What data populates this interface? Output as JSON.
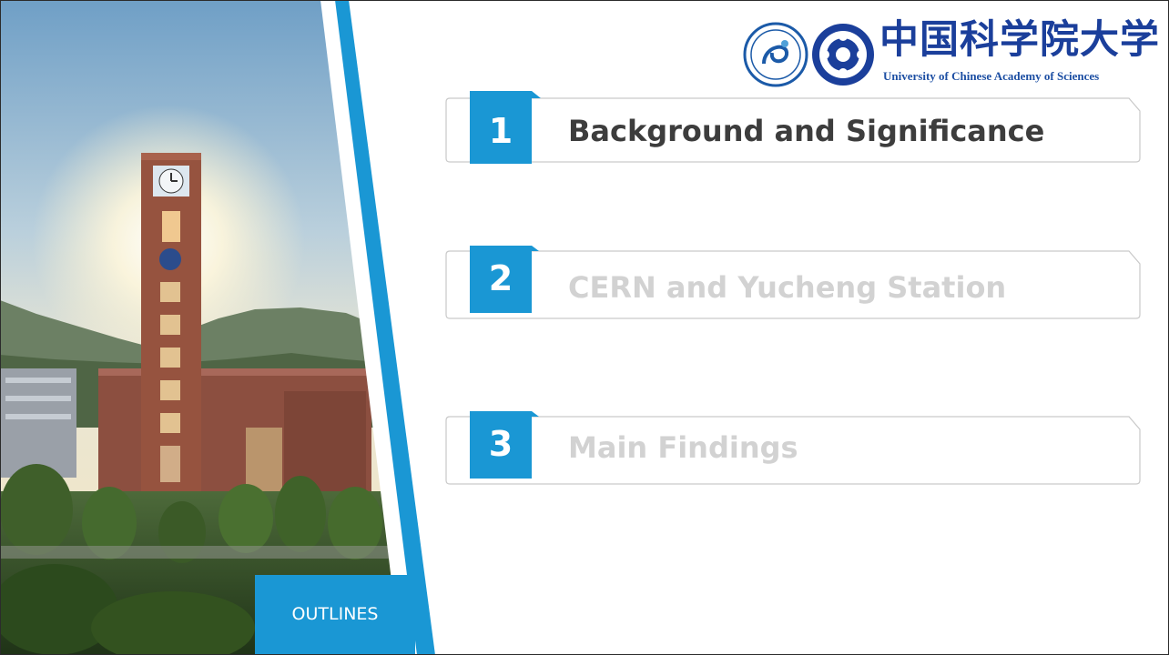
{
  "outline_label": "OUTLINES",
  "logo": {
    "cn_name": "中国科学院大学",
    "en_name": "University of Chinese Academy of Sciences"
  },
  "items": [
    {
      "number": "1",
      "title": "Background and Significance",
      "state": "active"
    },
    {
      "number": "2",
      "title": "CERN and Yucheng Station",
      "state": "inactive"
    },
    {
      "number": "3",
      "title": "Main Findings",
      "state": "inactive"
    }
  ],
  "colors": {
    "accent": "#1a97d4",
    "active_text": "#3d3d3d",
    "inactive_text": "#d2d2d2",
    "logo_blue": "#1b3f9b"
  },
  "icons": [
    "clock-tower-photo",
    "ucas-emblem-icon",
    "cas-emblem-icon"
  ]
}
